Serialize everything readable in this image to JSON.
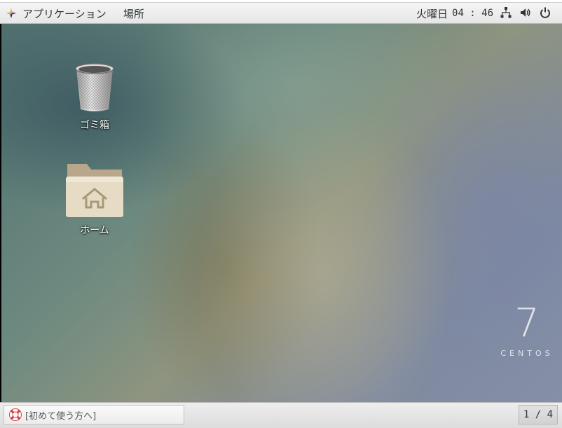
{
  "top_panel": {
    "applications_label": "アプリケーション",
    "places_label": "場所",
    "clock": {
      "day": "火曜日",
      "time": "04 : 46"
    },
    "tray_icons": [
      "network-icon",
      "volume-icon",
      "power-icon"
    ]
  },
  "desktop": {
    "icons": [
      {
        "label": "ゴミ箱",
        "icon": "trash-icon"
      },
      {
        "label": "ホーム",
        "icon": "home-folder-icon"
      }
    ],
    "brand": {
      "number": "7",
      "word": "CENTOS"
    }
  },
  "bottom_panel": {
    "taskbar_item": "[初めて使う方へ]",
    "workspace_indicator": "1 / 4"
  }
}
